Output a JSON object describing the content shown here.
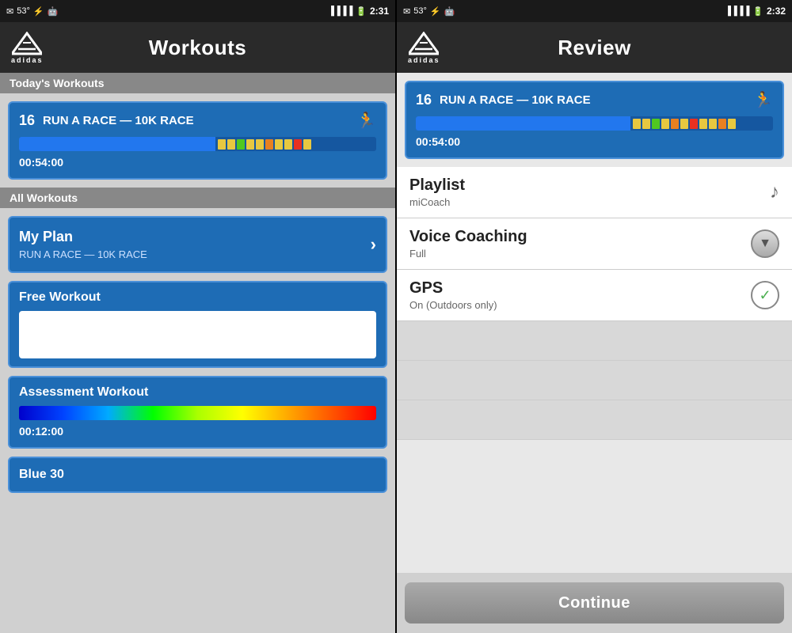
{
  "left_panel": {
    "status": {
      "temp": "53°",
      "time": "2:31"
    },
    "header": {
      "title": "Workouts",
      "logo_text": "adidas"
    },
    "sections": {
      "todays": "Today's Workouts",
      "all": "All Workouts"
    },
    "todays_workout": {
      "number": "16",
      "title": "RUN A RACE — 10K RACE",
      "time": "00:54:00"
    },
    "all_workouts": [
      {
        "type": "plan",
        "label": "My Plan",
        "subtitle": "RUN A RACE — 10K RACE"
      },
      {
        "type": "free",
        "label": "Free Workout"
      },
      {
        "type": "assessment",
        "label": "Assessment Workout",
        "time": "00:12:00"
      },
      {
        "type": "blue30",
        "label": "Blue 30"
      }
    ]
  },
  "right_panel": {
    "status": {
      "temp": "53°",
      "time": "2:32"
    },
    "header": {
      "title": "Review",
      "logo_text": "adidas"
    },
    "workout": {
      "number": "16",
      "title": "RUN A RACE — 10K RACE",
      "time": "00:54:00"
    },
    "review_items": [
      {
        "id": "playlist",
        "title": "Playlist",
        "subtitle": "miCoach",
        "icon": "music"
      },
      {
        "id": "voice_coaching",
        "title": "Voice Coaching",
        "subtitle": "Full",
        "icon": "dropdown"
      },
      {
        "id": "gps",
        "title": "GPS",
        "subtitle": "On (Outdoors only)",
        "icon": "check"
      }
    ],
    "continue_button": "Continue"
  }
}
